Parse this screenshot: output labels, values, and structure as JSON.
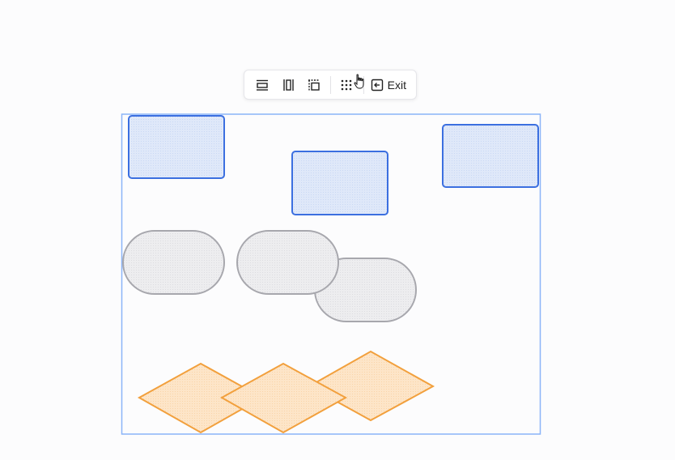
{
  "toolbar": {
    "buttons": [
      {
        "name": "align-horizontal-button",
        "icon": "align-horizontal-icon"
      },
      {
        "name": "align-vertical-button",
        "icon": "align-vertical-icon"
      },
      {
        "name": "align-frame-button",
        "icon": "align-frame-icon"
      },
      {
        "name": "grid-arrange-button",
        "icon": "grid-dots-icon"
      }
    ],
    "exit_label": "Exit",
    "exit_icon": "exit-icon"
  },
  "cursor_icon": "hand-pointer-icon",
  "colors": {
    "selection_border": "#8ab4f8",
    "rect_fill": "#dce7f9",
    "rect_stroke": "#3b6fe0",
    "pill_fill": "#ececee",
    "pill_stroke": "#a7a7ad",
    "diamond_fill": "#fde3c3",
    "diamond_stroke": "#f2a03d"
  }
}
